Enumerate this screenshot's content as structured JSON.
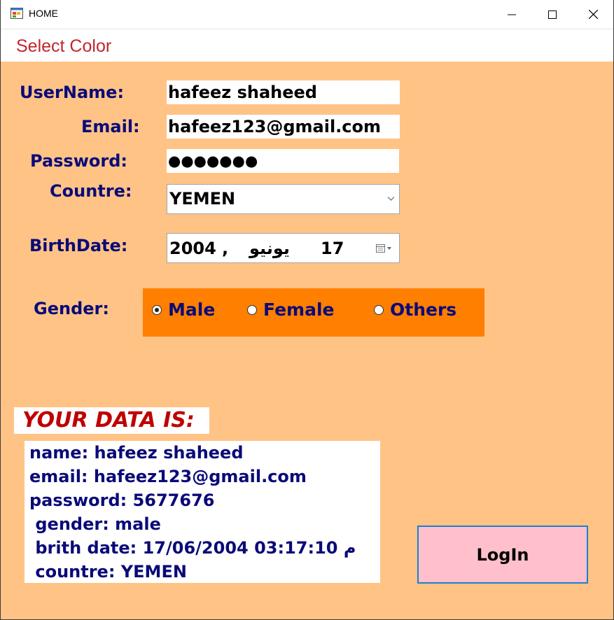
{
  "window": {
    "title": "HOME"
  },
  "menu": {
    "select_color": "Select Color"
  },
  "form": {
    "username_label": "UserName:",
    "username_value": "hafeez shaheed",
    "email_label": "Email:",
    "email_value": "hafeez123@gmail.com",
    "password_label": "Password:",
    "password_value": "●●●●●●●",
    "country_label": "Countre:",
    "country_value": "YEMEN",
    "birthdate_label": "BirthDate:",
    "birthdate_year": "2004",
    "birthdate_sep": ",",
    "birthdate_month": "يونيو",
    "birthdate_day": "17",
    "gender_label": "Gender:",
    "gender_options": [
      {
        "label": "Male",
        "selected": true
      },
      {
        "label": "Female",
        "selected": false
      },
      {
        "label": "Others",
        "selected": false
      }
    ]
  },
  "output": {
    "title": "YOUR DATA IS:",
    "lines": [
      "name: hafeez shaheed",
      "email: hafeez123@gmail.com",
      "password: 5677676",
      " gender: male",
      " brith date: 17/06/2004 03:17:10 م",
      " countre: YEMEN"
    ]
  },
  "buttons": {
    "login": "LogIn"
  },
  "colors": {
    "client_bg": "#ffc386",
    "gender_panel": "#ff7f00",
    "label_text": "#0a0a78",
    "data_title": "#c00000",
    "menu_text": "#c2262e",
    "login_bg": "#ffc0cb",
    "login_border": "#1e7fd0"
  },
  "icons": {
    "app": "app-window-icon",
    "minimize": "minimize-icon",
    "maximize": "maximize-icon",
    "close": "close-icon",
    "dropdown": "chevron-down-icon",
    "calendar": "calendar-icon"
  }
}
